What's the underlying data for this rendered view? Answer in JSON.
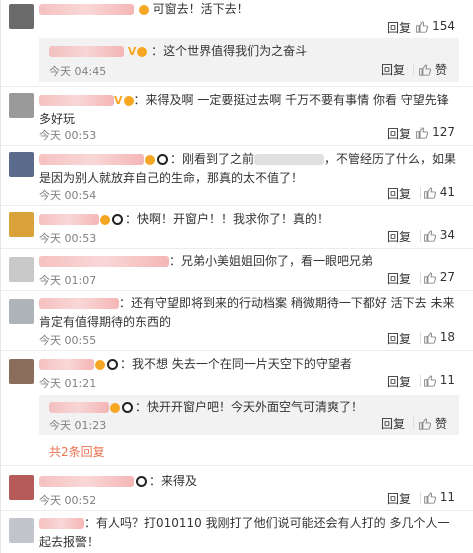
{
  "comments": [
    {
      "text": "可窗去！活下去！",
      "time": "",
      "reply": "回复",
      "likes": "154"
    },
    {
      "text": "：这个世界值得我们为之奋斗",
      "time": "今天 04:45",
      "reply": "回复",
      "likes": "赞"
    },
    {
      "text": "：来得及啊  一定要挺过去啊  千万不要有事情  你看 守望先锋多好玩",
      "time": "今天 00:53",
      "reply": "回复",
      "likes": "127"
    },
    {
      "text": "：刚看到了之前",
      "text2": "，不管经历了什么，如果是因为别人就放弃自己的生命，那真的太不值了！",
      "time": "今天 00:54",
      "reply": "回复",
      "likes": "41"
    },
    {
      "text": "：快啊！开窗户！！我求你了！真的！",
      "time": "今天 00:53",
      "reply": "回复",
      "likes": "34"
    },
    {
      "text": "：兄弟小美姐姐回你了，看一眼吧兄弟",
      "time": "今天 01:07",
      "reply": "回复",
      "likes": "27"
    },
    {
      "text": "：还有守望即将到来的行动档案 稍微期待一下都好 活下去 未来肯定有值得期待的东西的",
      "time": "今天 00:55",
      "reply": "回复",
      "likes": "18"
    },
    {
      "text": "：我不想 失去一个在同一片天空下的守望者",
      "time": "今天 01:21",
      "reply": "回复",
      "likes": "11"
    },
    {
      "text": "：快开开窗户吧！今天外面空气可清爽了！",
      "time": "今天 01:23",
      "reply": "回复",
      "likes": "赞"
    },
    {
      "text": "：来得及",
      "time": "今天 00:52",
      "reply": "回复",
      "likes": "11"
    },
    {
      "text": "：有人吗？打010110 我刚打了他们说可能还会有人打的 多几个人一起去报警！",
      "time": "",
      "reply": "",
      "likes": ""
    }
  ],
  "more_replies": "共2条回复",
  "colors": {
    "accent": "#eb7350",
    "badge": "#f5a623"
  }
}
